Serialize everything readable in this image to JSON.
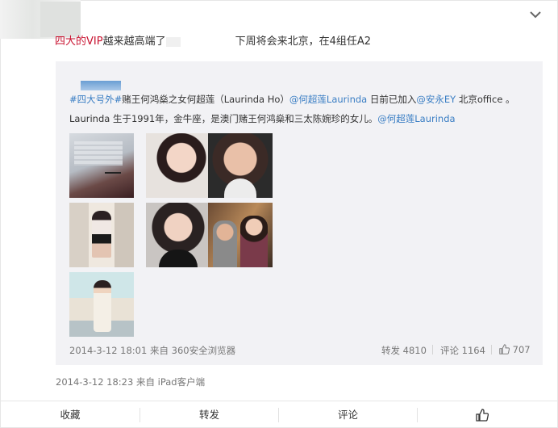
{
  "post": {
    "text_tag": "四大的VIP",
    "text_part1": "越来越高端了",
    "text_part2": "下周将会来北京，在4组任A2",
    "meta": "2014-3-12 18:23 来自 iPad客户端"
  },
  "repost": {
    "line1": {
      "hashtag": "#四大号外#",
      "text1": "赌王何鸿燊之女何超莲（Laurinda Ho）",
      "mention1": "@何超莲Laurinda",
      "text2": " 日前已加入",
      "mention2": "@安永EY",
      "text3": " 北京office 。"
    },
    "line2": {
      "text1": "Laurinda 生于1991年，金牛座，是澳门赌王何鸿燊和三太陈婉珍的女儿。",
      "mention": "@何超莲Laurinda"
    },
    "meta": "2014-3-12 18:01 来自 360安全浏览器",
    "actions": {
      "forward_label": "转发",
      "forward_count": "4810",
      "comment_label": "评论",
      "comment_count": "1164",
      "like_count": "707"
    }
  },
  "bottom_bar": {
    "favorite": "收藏",
    "forward": "转发",
    "comment": "评论"
  },
  "colors": {
    "tag": "#c8102e",
    "link": "#3a7ec4",
    "repost_bg": "#f2f2f5",
    "meta": "#777777"
  },
  "icons": [
    "chevron-down-icon",
    "thumbs-up-icon"
  ]
}
